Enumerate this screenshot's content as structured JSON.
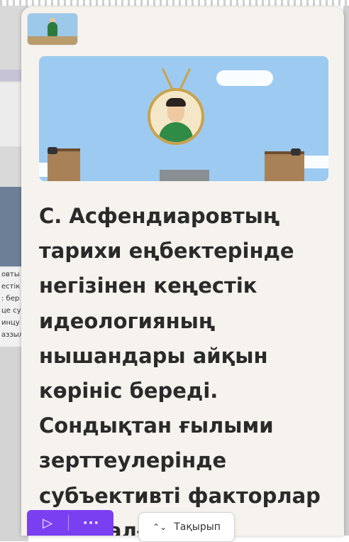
{
  "background_page": {
    "text_lines": [
      "овты",
      "естік",
      ": бер",
      "це су",
      "инцу",
      "аззыл"
    ]
  },
  "card": {
    "body_text": "С. Асфендиаровтың\nтарихи еңбектерінде\nнегізінен кеңестік\nидеологияның\nнышандары айқын\nкөрініс береді.\nСондықтан ғылыми\nзерттеулерінде\nсубъективті факторлар\nорын алған еді."
  },
  "controls": {
    "play_icon": "▷",
    "more_label": "···",
    "topic_icon": "⌃⌄",
    "topic_label": "Тақырып"
  },
  "colors": {
    "panel_bg": "#f6f3ee",
    "accent": "#7b3ff2",
    "sky": "#9dcaf0"
  },
  "icons": [
    "play-icon",
    "more-icon",
    "chevron-up-down-icon"
  ]
}
